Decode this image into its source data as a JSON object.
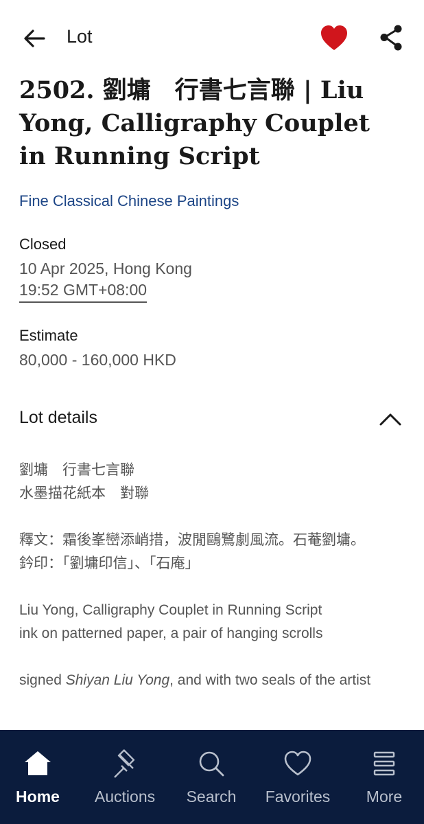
{
  "header": {
    "title": "Lot",
    "back_icon": "arrow-left-icon",
    "favorite_icon": "heart-filled-icon",
    "share_icon": "share-icon",
    "favorite_color": "#d0151c"
  },
  "lot": {
    "title": "2502. 劉墉　行書七言聯 | Liu Yong, Calligraphy Couplet in Running Script",
    "sale_name": "Fine Classical Chinese Paintings",
    "status": "Closed",
    "date": "10 Apr 2025, Hong Kong",
    "time": "19:52 GMT+08:00",
    "estimate_label": "Estimate",
    "estimate_value": "80,000 - 160,000 HKD"
  },
  "details": {
    "title": "Lot details",
    "toggle_icon": "chevron-up-icon",
    "chinese_title": "劉墉　行書七言聯",
    "chinese_medium": "水墨描花紙本　對聯",
    "inscription": "釋文：霜後峯巒添峭措，波閒鷗鷺劇風流。石菴劉墉。",
    "seals": "鈐印：「劉墉印信」、「石庵」",
    "english_title": "Liu Yong, Calligraphy Couplet in Running Script",
    "english_medium": "ink on patterned paper, a pair of hanging scrolls",
    "signed_prefix": "signed ",
    "signed_name": "Shiyan Liu Yong",
    "signed_suffix": ", and with two seals of the artist"
  },
  "nav": {
    "items": [
      {
        "label": "Home",
        "icon": "home-icon",
        "active": true
      },
      {
        "label": "Auctions",
        "icon": "gavel-icon",
        "active": false
      },
      {
        "label": "Search",
        "icon": "search-icon",
        "active": false
      },
      {
        "label": "Favorites",
        "icon": "heart-outline-icon",
        "active": false
      },
      {
        "label": "More",
        "icon": "menu-icon",
        "active": false
      }
    ],
    "background": "#0b1c3d"
  }
}
